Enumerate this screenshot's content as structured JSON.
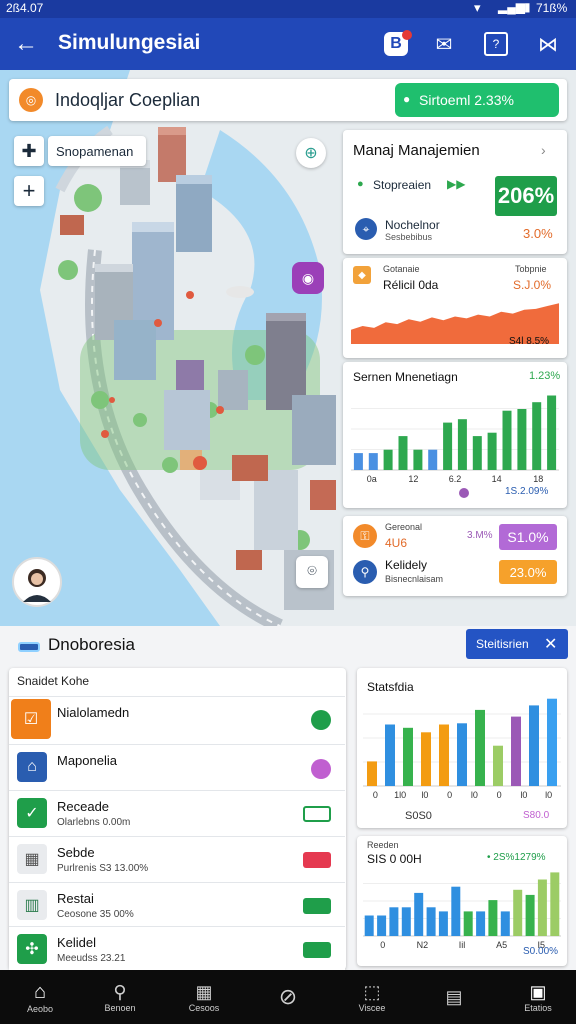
{
  "status": {
    "time": "2ß4.07",
    "battery": "71ß%"
  },
  "appbar": {
    "title": "Simulungesiai"
  },
  "header": {
    "title": "Indoqljar Coeplian",
    "badge": "Sirtoeml 2.33%"
  },
  "map": {
    "search_label": "Snopamenan"
  },
  "mgmt": {
    "title": "Manaj Manajemien",
    "item1": "Stopreaien",
    "value": "206%",
    "item2_title": "Nochelnor",
    "item2_sub": "Sesbebibus",
    "item2_value": "3.0%"
  },
  "area": {
    "label1": "Gotanaie",
    "label2": "Rélicil 0da",
    "val1": "Tobpnie",
    "val2": "S.J.0%",
    "val3": "S4l 8.5%"
  },
  "bar1": {
    "title": "Sernen Mnenetiagn",
    "value": "1.23%",
    "xticks": [
      "0a",
      "12",
      "6.2",
      "14",
      "18"
    ],
    "footer": "1S.2.09%"
  },
  "info": {
    "label1": "Gereonal",
    "value1": "4U6",
    "value2": "3.M%",
    "badge1": "S1.0%",
    "label2": "Kelidely",
    "sub2": "Bisnecnlaisam",
    "badge2": "23.0%"
  },
  "dash": {
    "title": "Dnoboresia",
    "button": "Steitisrien"
  },
  "list": {
    "header": "Snaidet Kohe",
    "items": [
      {
        "title": "Nialolamedn",
        "sub": ""
      },
      {
        "title": "Maponelia",
        "sub": ""
      },
      {
        "title": "Receade",
        "sub": "Olarlebns 0.00m"
      },
      {
        "title": "Sebde",
        "sub": "Purlrenis S3 13.00%"
      },
      {
        "title": "Restai",
        "sub": "Ceosone 35 00%"
      },
      {
        "title": "Kelidel",
        "sub": "Meeudss 23.21"
      }
    ]
  },
  "stat1": {
    "title": "Statsfdia",
    "xticks": [
      "0",
      "1l0",
      "l0",
      "0",
      "l0",
      "0",
      "l0",
      "l0"
    ],
    "footer_left": "S0S0",
    "footer_right": "S80.0"
  },
  "stat2": {
    "title": "Reeden",
    "value": "SIS 0 00H",
    "change": "• 2S%1279%",
    "xticks": [
      "0",
      "N2",
      "Iil",
      "A5",
      "I5"
    ],
    "footer": "S0.00%"
  },
  "nav": [
    "Aeobo",
    "Benoen",
    "Cesoos",
    "",
    "Viscee",
    "",
    "Etatios"
  ],
  "chart_data": [
    {
      "type": "area",
      "values": [
        30,
        38,
        34,
        46,
        42,
        52,
        47,
        56,
        50,
        58,
        54,
        62,
        58,
        68,
        64,
        72,
        74,
        80,
        86
      ]
    },
    {
      "type": "bar",
      "title": "Sernen Mnenetiagn",
      "categories": [
        "0a",
        "",
        "12",
        "",
        "6.2",
        "",
        "14",
        "",
        "18",
        ""
      ],
      "values": [
        10,
        10,
        12,
        20,
        12,
        12,
        28,
        30,
        20,
        22,
        35,
        36,
        40,
        44
      ],
      "colors": [
        "#4a90e2",
        "#4a90e2",
        "#2ea84f",
        "#2ea84f",
        "#2ea84f",
        "#4a90e2",
        "#2ea84f",
        "#2ea84f",
        "#2ea84f",
        "#2ea84f",
        "#2ea84f",
        "#2ea84f",
        "#2ea84f",
        "#2ea84f"
      ]
    },
    {
      "type": "bar",
      "title": "Statsfdia",
      "values": [
        22,
        55,
        52,
        48,
        55,
        56,
        68,
        36,
        62,
        72,
        78
      ],
      "colors": [
        "#f39c12",
        "#2f8fe0",
        "#37b24d",
        "#f39c12",
        "#f39c12",
        "#2f8fe0",
        "#37b24d",
        "#9ccc65",
        "#9b59b6",
        "#2f8fe0",
        "#3aa0f0"
      ]
    },
    {
      "type": "bar",
      "title": "Reeden",
      "values": [
        20,
        20,
        28,
        28,
        42,
        28,
        24,
        48,
        24,
        24,
        35,
        24,
        45,
        40,
        55,
        62
      ],
      "colors": [
        "#2f8fe0",
        "#2f8fe0",
        "#2f8fe0",
        "#2f8fe0",
        "#2f8fe0",
        "#2f8fe0",
        "#2f8fe0",
        "#2f8fe0",
        "#37b24d",
        "#2f8fe0",
        "#37b24d",
        "#2f8fe0",
        "#9ccc65",
        "#37b24d",
        "#9ccc65",
        "#9ccc65"
      ]
    }
  ]
}
